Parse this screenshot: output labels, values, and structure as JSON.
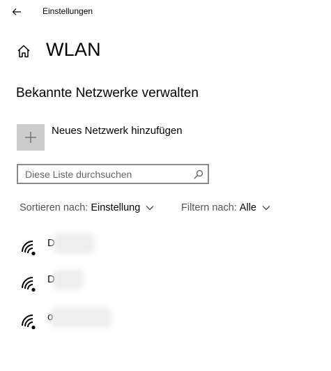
{
  "header": {
    "app_title": "Einstellungen",
    "back_icon": "arrow-left-icon"
  },
  "page": {
    "title": "WLAN",
    "home_icon": "home-icon"
  },
  "section": {
    "title": "Bekannte Netzwerke verwalten"
  },
  "add_network": {
    "label": "Neues Netzwerk hinzufügen",
    "icon": "plus-icon"
  },
  "search": {
    "placeholder": "Diese Liste durchsuchen",
    "value": "",
    "icon": "search-icon"
  },
  "sort": {
    "label": "Sortieren nach:",
    "value": "Einstellung"
  },
  "filter": {
    "label": "Filtern nach:",
    "value": "Alle"
  },
  "networks": [
    {
      "name_visible": "D",
      "icon": "wifi-icon"
    },
    {
      "name_visible": "D",
      "icon": "wifi-icon"
    },
    {
      "name_visible": "o",
      "icon": "wifi-icon"
    }
  ],
  "colors": {
    "tile_bg": "#cccccc",
    "border": "#8a8a8a",
    "muted_text": "#555555"
  }
}
